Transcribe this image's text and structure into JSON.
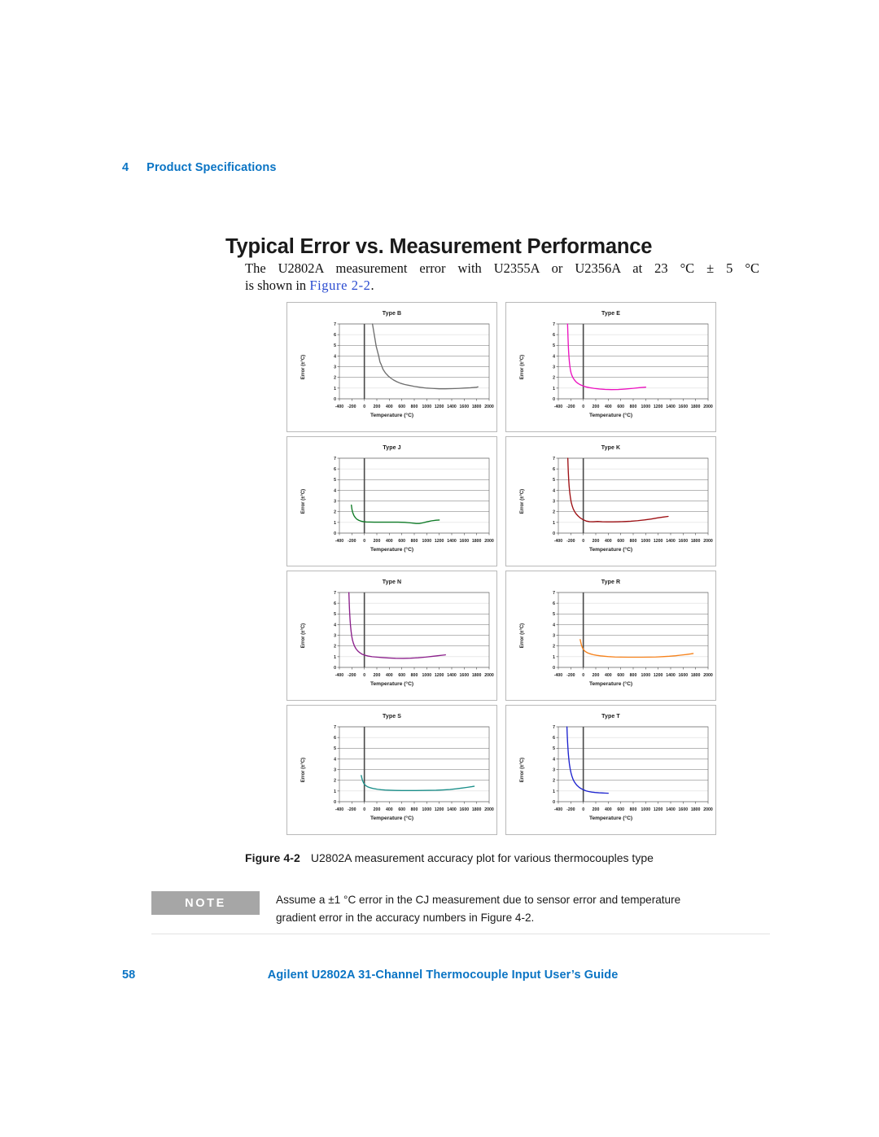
{
  "header": {
    "chapter_number": "4",
    "chapter_title": "Product Specifications"
  },
  "section": {
    "heading": "Typical Error vs. Measurement Performance",
    "paragraph_line1": "The U2802A measurement error with U2355A or U2356A at 23 °C ± 5 °C",
    "paragraph_line2_prefix": "is shown in ",
    "paragraph_xref": "Figure 2-2",
    "paragraph_line2_suffix": "."
  },
  "figure": {
    "label": "Figure 4-2",
    "caption": "U2802A measurement accuracy plot for various thermocouples type"
  },
  "note": {
    "badge": "NOTE",
    "line1": "Assume a ±1 °C error in the CJ measurement due to sensor error and temperature",
    "line2": "gradient error in the accuracy numbers in Figure 4-2."
  },
  "footer": {
    "page_number": "58",
    "title": "Agilent U2802A 31-Channel Thermocouple Input User’s Guide"
  },
  "chart_data": [
    {
      "type": "line",
      "title": "Type B",
      "xlabel": "Temperature (°C)",
      "ylabel": "Error (±°C)",
      "xlim": [
        -400,
        2000
      ],
      "ylim": [
        0,
        7
      ],
      "xticks": [
        -400,
        -200,
        0,
        200,
        400,
        600,
        800,
        1000,
        1200,
        1400,
        1600,
        1800,
        2000
      ],
      "yticks": [
        0,
        1,
        2,
        3,
        4,
        5,
        6,
        7
      ],
      "grid": true,
      "color": "#6e6e6e",
      "series": [
        {
          "name": "Type B error",
          "x": [
            130,
            150,
            170,
            190,
            210,
            230,
            250,
            270,
            300,
            340,
            380,
            420,
            470,
            520,
            580,
            650,
            720,
            800,
            900,
            1000,
            1100,
            1200,
            1300,
            1400,
            1500,
            1600,
            1700,
            1800,
            1820
          ],
          "y": [
            7.0,
            6.3,
            5.6,
            4.9,
            4.45,
            4.0,
            3.45,
            3.2,
            2.75,
            2.4,
            2.15,
            1.95,
            1.75,
            1.6,
            1.45,
            1.33,
            1.25,
            1.16,
            1.07,
            1.0,
            0.97,
            0.94,
            0.94,
            0.95,
            0.97,
            1.0,
            1.03,
            1.08,
            1.12
          ]
        }
      ]
    },
    {
      "type": "line",
      "title": "Type E",
      "xlabel": "Temperature (°C)",
      "ylabel": "Error (±°C)",
      "xlim": [
        -400,
        2000
      ],
      "ylim": [
        0,
        7
      ],
      "xticks": [
        -400,
        -200,
        0,
        200,
        400,
        600,
        800,
        1000,
        1200,
        1400,
        1600,
        1800,
        2000
      ],
      "yticks": [
        0,
        1,
        2,
        3,
        4,
        5,
        6,
        7
      ],
      "grid": true,
      "color": "#ec13c0",
      "series": [
        {
          "name": "Type E error",
          "x": [
            -252,
            -248,
            -244,
            -240,
            -235,
            -230,
            -222,
            -214,
            -205,
            -195,
            -180,
            -160,
            -140,
            -115,
            -85,
            -50,
            -10,
            40,
            100,
            180,
            260,
            350,
            450,
            560,
            680,
            800,
            900,
            980,
            1000
          ],
          "y": [
            7.0,
            6.3,
            5.6,
            5.0,
            4.4,
            3.95,
            3.4,
            3.0,
            2.65,
            2.4,
            2.15,
            1.92,
            1.75,
            1.58,
            1.44,
            1.32,
            1.22,
            1.12,
            1.04,
            0.97,
            0.92,
            0.88,
            0.86,
            0.87,
            0.92,
            0.98,
            1.04,
            1.08,
            1.09
          ]
        }
      ]
    },
    {
      "type": "line",
      "title": "Type J",
      "xlabel": "Temperature (°C)",
      "ylabel": "Error (±°C)",
      "xlim": [
        -400,
        2000
      ],
      "ylim": [
        0,
        7
      ],
      "xticks": [
        -400,
        -200,
        0,
        200,
        400,
        600,
        800,
        1000,
        1200,
        1400,
        1600,
        1800,
        2000
      ],
      "yticks": [
        0,
        1,
        2,
        3,
        4,
        5,
        6,
        7
      ],
      "grid": true,
      "color": "#0d7a25",
      "series": [
        {
          "name": "Type J error",
          "x": [
            -208,
            -203,
            -198,
            -190,
            -180,
            -165,
            -145,
            -120,
            -90,
            -55,
            -15,
            30,
            90,
            160,
            240,
            330,
            430,
            540,
            650,
            750,
            830,
            880,
            930,
            1000,
            1080,
            1150,
            1200
          ],
          "y": [
            2.62,
            2.4,
            2.2,
            2.0,
            1.82,
            1.62,
            1.45,
            1.3,
            1.2,
            1.12,
            1.07,
            1.04,
            1.03,
            1.02,
            1.02,
            1.02,
            1.02,
            1.02,
            1.0,
            0.95,
            0.9,
            0.9,
            0.95,
            1.05,
            1.15,
            1.2,
            1.22
          ]
        }
      ]
    },
    {
      "type": "line",
      "title": "Type K",
      "xlabel": "Temperature (°C)",
      "ylabel": "Error (±°C)",
      "xlim": [
        -400,
        2000
      ],
      "ylim": [
        0,
        7
      ],
      "xticks": [
        -400,
        -200,
        0,
        200,
        400,
        600,
        800,
        1000,
        1200,
        1400,
        1600,
        1800,
        2000
      ],
      "yticks": [
        0,
        1,
        2,
        3,
        4,
        5,
        6,
        7
      ],
      "grid": true,
      "color": "#9e1014",
      "series": [
        {
          "name": "Type K error",
          "x": [
            -248,
            -244,
            -240,
            -234,
            -227,
            -218,
            -207,
            -194,
            -178,
            -160,
            -138,
            -112,
            -80,
            -45,
            -5,
            45,
            100,
            160,
            230,
            300,
            380,
            470,
            560,
            660,
            760,
            870,
            980,
            1090,
            1190,
            1280,
            1360
          ],
          "y": [
            7.0,
            6.3,
            5.7,
            5.0,
            4.4,
            3.85,
            3.35,
            2.9,
            2.55,
            2.25,
            2.0,
            1.78,
            1.58,
            1.4,
            1.26,
            1.13,
            1.07,
            1.06,
            1.09,
            1.06,
            1.05,
            1.05,
            1.06,
            1.08,
            1.11,
            1.16,
            1.23,
            1.32,
            1.42,
            1.5,
            1.56
          ]
        }
      ]
    },
    {
      "type": "line",
      "title": "Type N",
      "xlabel": "Temperature (°C)",
      "ylabel": "Error (±°C)",
      "xlim": [
        -400,
        2000
      ],
      "ylim": [
        0,
        7
      ],
      "xticks": [
        -400,
        -200,
        0,
        200,
        400,
        600,
        800,
        1000,
        1200,
        1400,
        1600,
        1800,
        2000
      ],
      "yticks": [
        0,
        1,
        2,
        3,
        4,
        5,
        6,
        7
      ],
      "grid": true,
      "color": "#8b1f8b",
      "series": [
        {
          "name": "Type N error",
          "x": [
            -248,
            -244,
            -240,
            -235,
            -229,
            -222,
            -213,
            -203,
            -190,
            -175,
            -157,
            -135,
            -108,
            -75,
            -38,
            5,
            60,
            125,
            200,
            290,
            390,
            500,
            620,
            740,
            860,
            980,
            1090,
            1190,
            1270,
            1300
          ],
          "y": [
            7.0,
            6.35,
            5.7,
            5.05,
            4.45,
            3.9,
            3.4,
            2.95,
            2.55,
            2.25,
            1.98,
            1.75,
            1.55,
            1.38,
            1.24,
            1.14,
            1.06,
            1.0,
            0.96,
            0.92,
            0.88,
            0.85,
            0.84,
            0.86,
            0.9,
            0.96,
            1.03,
            1.1,
            1.15,
            1.17
          ]
        }
      ]
    },
    {
      "type": "line",
      "title": "Type R",
      "xlabel": "Temperature (°C)",
      "ylabel": "Error (±°C)",
      "xlim": [
        -400,
        2000
      ],
      "ylim": [
        0,
        7
      ],
      "xticks": [
        -400,
        -200,
        0,
        200,
        400,
        600,
        800,
        1000,
        1200,
        1400,
        1600,
        1800,
        2000
      ],
      "yticks": [
        0,
        1,
        2,
        3,
        4,
        5,
        6,
        7
      ],
      "grid": true,
      "color": "#f7821b",
      "series": [
        {
          "name": "Type R error",
          "x": [
            -50,
            -40,
            -30,
            -18,
            -5,
            10,
            30,
            55,
            85,
            120,
            165,
            215,
            275,
            340,
            420,
            510,
            610,
            720,
            830,
            940,
            1050,
            1160,
            1270,
            1380,
            1480,
            1570,
            1650,
            1720,
            1760
          ],
          "y": [
            2.6,
            2.35,
            2.1,
            1.9,
            1.74,
            1.62,
            1.5,
            1.4,
            1.32,
            1.25,
            1.18,
            1.13,
            1.08,
            1.04,
            1.0,
            0.97,
            0.96,
            0.95,
            0.95,
            0.95,
            0.96,
            0.97,
            1.0,
            1.04,
            1.09,
            1.15,
            1.2,
            1.26,
            1.3
          ]
        }
      ]
    },
    {
      "type": "line",
      "title": "Type S",
      "xlabel": "Temperature (°C)",
      "ylabel": "Error (±°C)",
      "xlim": [
        -400,
        2000
      ],
      "ylim": [
        0,
        7
      ],
      "xticks": [
        -400,
        -200,
        0,
        200,
        400,
        600,
        800,
        1000,
        1200,
        1400,
        1600,
        1800,
        2000
      ],
      "yticks": [
        0,
        1,
        2,
        3,
        4,
        5,
        6,
        7
      ],
      "grid": true,
      "color": "#1b8f8a",
      "series": [
        {
          "name": "Type S error",
          "x": [
            -50,
            -42,
            -33,
            -22,
            -10,
            5,
            25,
            50,
            80,
            115,
            160,
            210,
            270,
            335,
            410,
            500,
            600,
            710,
            820,
            930,
            1040,
            1150,
            1260,
            1370,
            1470,
            1560,
            1650,
            1720,
            1760
          ],
          "y": [
            2.45,
            2.25,
            2.05,
            1.88,
            1.72,
            1.6,
            1.49,
            1.4,
            1.33,
            1.27,
            1.21,
            1.16,
            1.12,
            1.09,
            1.07,
            1.05,
            1.04,
            1.04,
            1.04,
            1.05,
            1.06,
            1.07,
            1.1,
            1.14,
            1.2,
            1.27,
            1.34,
            1.4,
            1.44
          ]
        }
      ]
    },
    {
      "type": "line",
      "title": "Type T",
      "xlabel": "Temperature (°C)",
      "ylabel": "Error (±°C)",
      "xlim": [
        -400,
        2000
      ],
      "ylim": [
        0,
        7
      ],
      "xticks": [
        -400,
        -200,
        0,
        200,
        400,
        600,
        800,
        1000,
        1200,
        1400,
        1600,
        1800,
        2000
      ],
      "yticks": [
        0,
        1,
        2,
        3,
        4,
        5,
        6,
        7
      ],
      "grid": true,
      "color": "#1c22cf",
      "series": [
        {
          "name": "Type T error",
          "x": [
            -262,
            -258,
            -253,
            -247,
            -240,
            -232,
            -222,
            -211,
            -198,
            -183,
            -166,
            -146,
            -123,
            -97,
            -68,
            -35,
            0,
            40,
            85,
            135,
            190,
            250,
            310,
            360,
            400
          ],
          "y": [
            7.0,
            6.35,
            5.7,
            5.1,
            4.5,
            4.0,
            3.5,
            3.1,
            2.72,
            2.4,
            2.12,
            1.88,
            1.68,
            1.5,
            1.35,
            1.22,
            1.12,
            1.02,
            0.95,
            0.9,
            0.86,
            0.83,
            0.81,
            0.8,
            0.79
          ]
        }
      ]
    }
  ]
}
